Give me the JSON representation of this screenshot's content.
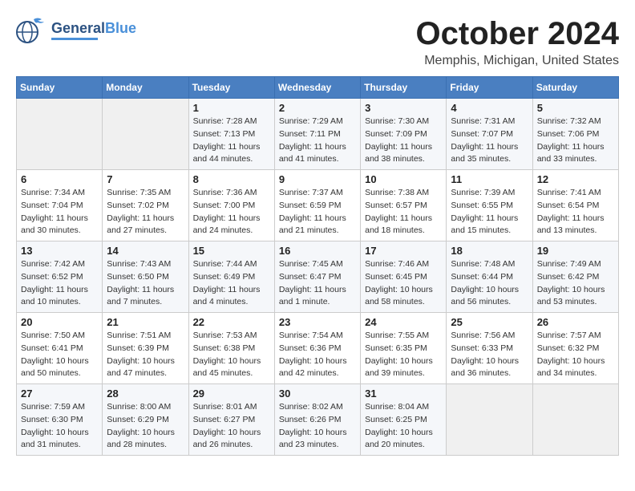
{
  "header": {
    "logo_general": "General",
    "logo_blue": "Blue",
    "month_title": "October 2024",
    "location": "Memphis, Michigan, United States"
  },
  "calendar": {
    "days_of_week": [
      "Sunday",
      "Monday",
      "Tuesday",
      "Wednesday",
      "Thursday",
      "Friday",
      "Saturday"
    ],
    "weeks": [
      [
        {
          "day": "",
          "sunrise": "",
          "sunset": "",
          "daylight": ""
        },
        {
          "day": "",
          "sunrise": "",
          "sunset": "",
          "daylight": ""
        },
        {
          "day": "1",
          "sunrise": "Sunrise: 7:28 AM",
          "sunset": "Sunset: 7:13 PM",
          "daylight": "Daylight: 11 hours and 44 minutes."
        },
        {
          "day": "2",
          "sunrise": "Sunrise: 7:29 AM",
          "sunset": "Sunset: 7:11 PM",
          "daylight": "Daylight: 11 hours and 41 minutes."
        },
        {
          "day": "3",
          "sunrise": "Sunrise: 7:30 AM",
          "sunset": "Sunset: 7:09 PM",
          "daylight": "Daylight: 11 hours and 38 minutes."
        },
        {
          "day": "4",
          "sunrise": "Sunrise: 7:31 AM",
          "sunset": "Sunset: 7:07 PM",
          "daylight": "Daylight: 11 hours and 35 minutes."
        },
        {
          "day": "5",
          "sunrise": "Sunrise: 7:32 AM",
          "sunset": "Sunset: 7:06 PM",
          "daylight": "Daylight: 11 hours and 33 minutes."
        }
      ],
      [
        {
          "day": "6",
          "sunrise": "Sunrise: 7:34 AM",
          "sunset": "Sunset: 7:04 PM",
          "daylight": "Daylight: 11 hours and 30 minutes."
        },
        {
          "day": "7",
          "sunrise": "Sunrise: 7:35 AM",
          "sunset": "Sunset: 7:02 PM",
          "daylight": "Daylight: 11 hours and 27 minutes."
        },
        {
          "day": "8",
          "sunrise": "Sunrise: 7:36 AM",
          "sunset": "Sunset: 7:00 PM",
          "daylight": "Daylight: 11 hours and 24 minutes."
        },
        {
          "day": "9",
          "sunrise": "Sunrise: 7:37 AM",
          "sunset": "Sunset: 6:59 PM",
          "daylight": "Daylight: 11 hours and 21 minutes."
        },
        {
          "day": "10",
          "sunrise": "Sunrise: 7:38 AM",
          "sunset": "Sunset: 6:57 PM",
          "daylight": "Daylight: 11 hours and 18 minutes."
        },
        {
          "day": "11",
          "sunrise": "Sunrise: 7:39 AM",
          "sunset": "Sunset: 6:55 PM",
          "daylight": "Daylight: 11 hours and 15 minutes."
        },
        {
          "day": "12",
          "sunrise": "Sunrise: 7:41 AM",
          "sunset": "Sunset: 6:54 PM",
          "daylight": "Daylight: 11 hours and 13 minutes."
        }
      ],
      [
        {
          "day": "13",
          "sunrise": "Sunrise: 7:42 AM",
          "sunset": "Sunset: 6:52 PM",
          "daylight": "Daylight: 11 hours and 10 minutes."
        },
        {
          "day": "14",
          "sunrise": "Sunrise: 7:43 AM",
          "sunset": "Sunset: 6:50 PM",
          "daylight": "Daylight: 11 hours and 7 minutes."
        },
        {
          "day": "15",
          "sunrise": "Sunrise: 7:44 AM",
          "sunset": "Sunset: 6:49 PM",
          "daylight": "Daylight: 11 hours and 4 minutes."
        },
        {
          "day": "16",
          "sunrise": "Sunrise: 7:45 AM",
          "sunset": "Sunset: 6:47 PM",
          "daylight": "Daylight: 11 hours and 1 minute."
        },
        {
          "day": "17",
          "sunrise": "Sunrise: 7:46 AM",
          "sunset": "Sunset: 6:45 PM",
          "daylight": "Daylight: 10 hours and 58 minutes."
        },
        {
          "day": "18",
          "sunrise": "Sunrise: 7:48 AM",
          "sunset": "Sunset: 6:44 PM",
          "daylight": "Daylight: 10 hours and 56 minutes."
        },
        {
          "day": "19",
          "sunrise": "Sunrise: 7:49 AM",
          "sunset": "Sunset: 6:42 PM",
          "daylight": "Daylight: 10 hours and 53 minutes."
        }
      ],
      [
        {
          "day": "20",
          "sunrise": "Sunrise: 7:50 AM",
          "sunset": "Sunset: 6:41 PM",
          "daylight": "Daylight: 10 hours and 50 minutes."
        },
        {
          "day": "21",
          "sunrise": "Sunrise: 7:51 AM",
          "sunset": "Sunset: 6:39 PM",
          "daylight": "Daylight: 10 hours and 47 minutes."
        },
        {
          "day": "22",
          "sunrise": "Sunrise: 7:53 AM",
          "sunset": "Sunset: 6:38 PM",
          "daylight": "Daylight: 10 hours and 45 minutes."
        },
        {
          "day": "23",
          "sunrise": "Sunrise: 7:54 AM",
          "sunset": "Sunset: 6:36 PM",
          "daylight": "Daylight: 10 hours and 42 minutes."
        },
        {
          "day": "24",
          "sunrise": "Sunrise: 7:55 AM",
          "sunset": "Sunset: 6:35 PM",
          "daylight": "Daylight: 10 hours and 39 minutes."
        },
        {
          "day": "25",
          "sunrise": "Sunrise: 7:56 AM",
          "sunset": "Sunset: 6:33 PM",
          "daylight": "Daylight: 10 hours and 36 minutes."
        },
        {
          "day": "26",
          "sunrise": "Sunrise: 7:57 AM",
          "sunset": "Sunset: 6:32 PM",
          "daylight": "Daylight: 10 hours and 34 minutes."
        }
      ],
      [
        {
          "day": "27",
          "sunrise": "Sunrise: 7:59 AM",
          "sunset": "Sunset: 6:30 PM",
          "daylight": "Daylight: 10 hours and 31 minutes."
        },
        {
          "day": "28",
          "sunrise": "Sunrise: 8:00 AM",
          "sunset": "Sunset: 6:29 PM",
          "daylight": "Daylight: 10 hours and 28 minutes."
        },
        {
          "day": "29",
          "sunrise": "Sunrise: 8:01 AM",
          "sunset": "Sunset: 6:27 PM",
          "daylight": "Daylight: 10 hours and 26 minutes."
        },
        {
          "day": "30",
          "sunrise": "Sunrise: 8:02 AM",
          "sunset": "Sunset: 6:26 PM",
          "daylight": "Daylight: 10 hours and 23 minutes."
        },
        {
          "day": "31",
          "sunrise": "Sunrise: 8:04 AM",
          "sunset": "Sunset: 6:25 PM",
          "daylight": "Daylight: 10 hours and 20 minutes."
        },
        {
          "day": "",
          "sunrise": "",
          "sunset": "",
          "daylight": ""
        },
        {
          "day": "",
          "sunrise": "",
          "sunset": "",
          "daylight": ""
        }
      ]
    ]
  }
}
